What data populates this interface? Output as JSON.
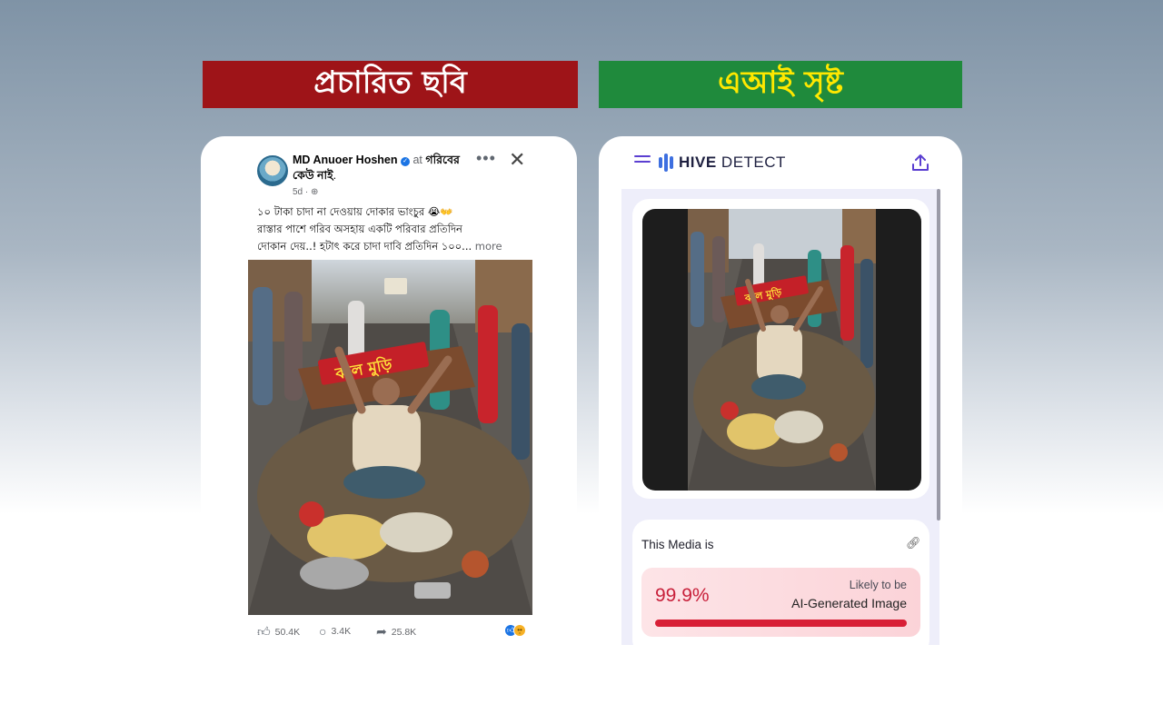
{
  "banners": {
    "left": "প্রচারিত ছবি",
    "right": "এআই সৃষ্ট"
  },
  "facebook_post": {
    "author": "MD Anuoer Hoshen",
    "at_label": "at",
    "location": "গরিবের কেউ নাই",
    "time": "5d",
    "text_line1": "১০ টাকা চাদা না দেওয়ায় দোকার ভাংচুর 😭👐",
    "text_line2": "রাস্তার পাশে গরিব অসহায় একটি পরিবার প্রতিদিন",
    "text_line3": "দোকান দেয়..! হটাৎ করে চাদা দাবি প্রতিদিন ১০০...",
    "see_more": "more",
    "image_sign_text": "ঝাল মুড়ি",
    "likes": "50.4K",
    "comments": "3.4K",
    "shares": "25.8K",
    "icons": {
      "more": "more-options-icon",
      "close": "close-icon",
      "globe": "globe-icon"
    }
  },
  "hive": {
    "brand_bold": "HIVE",
    "brand_light": "DETECT",
    "image_sign_text": "ঝাল মুড়ি",
    "result_title": "This Media is",
    "percentage": "99.9%",
    "likely_label": "Likely to be",
    "classification": "AI-Generated Image",
    "confidence": 0.999,
    "colors": {
      "accent": "#5b3fd1",
      "alert": "#d81f36",
      "brand": "#3d6fe0"
    }
  }
}
